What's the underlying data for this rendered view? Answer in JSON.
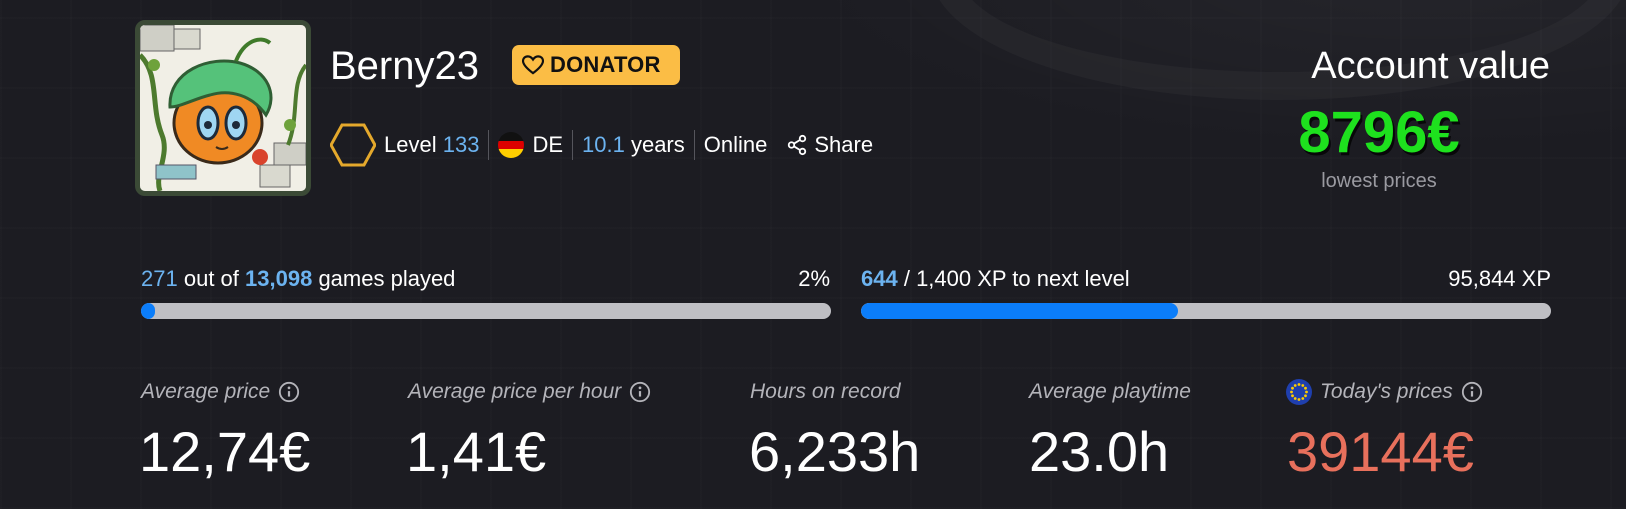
{
  "profile": {
    "username": "Berny23",
    "badge": "DONATOR",
    "level_label": "Level",
    "level": "133",
    "country": "DE",
    "years_value": "10.1",
    "years_label": "years",
    "status": "Online",
    "share_label": "Share"
  },
  "account": {
    "label": "Account value",
    "value": "8796€",
    "note": "lowest prices"
  },
  "games_progress": {
    "played": "271",
    "out_of_label": "out of",
    "total": "13,098",
    "suffix": "games played",
    "percent_label": "2%",
    "fraction": 0.021
  },
  "xp_progress": {
    "current": "644",
    "rest": "/ 1,400 XP to next level",
    "total_xp": "95,844 XP",
    "fraction": 0.46
  },
  "stats": [
    {
      "label": "Average price",
      "value": "12,74€"
    },
    {
      "label": "Average price per hour",
      "value": "1,41€"
    },
    {
      "label": "Hours on record",
      "value": "6,233h"
    },
    {
      "label": "Average playtime",
      "value": "23.0h"
    },
    {
      "label": "Today's prices",
      "value": "39144€"
    }
  ],
  "colors": {
    "accent_blue": "#0b7dfa",
    "link_blue": "#6cb3f0",
    "donator_bg": "#fbbd45",
    "account_value": "#1ee11e",
    "todays_prices": "#e8705c",
    "level_hex": "#e5a92c"
  },
  "icons": {
    "badge": "heart-icon",
    "level": "hexagon-icon",
    "country": "germany-flag-icon",
    "share": "share-icon",
    "info": "info-icon",
    "prices": "eu-flag-icon"
  }
}
